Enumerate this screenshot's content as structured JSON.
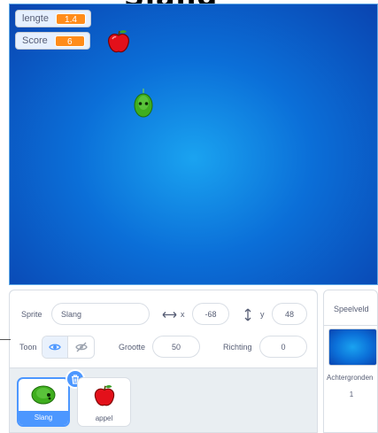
{
  "page": {
    "title": "Slang"
  },
  "stage": {
    "monitors": [
      {
        "label": "lengte",
        "value": "1.4"
      },
      {
        "label": "Score",
        "value": "6"
      }
    ]
  },
  "sprite_info": {
    "sprite_label": "Sprite",
    "sprite_name": "Slang",
    "x_label": "x",
    "x_value": "-68",
    "y_label": "y",
    "y_value": "48",
    "show_label": "Toon",
    "size_label": "Grootte",
    "size_value": "50",
    "direction_label": "Richting",
    "direction_value": "0"
  },
  "sprites": [
    {
      "name": "Slang",
      "selected": true
    },
    {
      "name": "appel",
      "selected": false
    }
  ],
  "stage_panel": {
    "title": "Speelveld",
    "backdrops_label": "Achtergronden",
    "backdrops_count": "1"
  },
  "icons": {
    "apple": "apple-icon",
    "snake": "snake-icon",
    "x_arrows": "horizontal-arrows-icon",
    "y_arrows": "vertical-arrows-icon",
    "eye": "eye-icon",
    "eye_hidden": "eye-slash-icon",
    "trash": "trash-icon"
  },
  "colors": {
    "accent": "#4c97ff",
    "monitor_value": "#ff8c1a",
    "stage_blue": "#0b6fd8"
  }
}
